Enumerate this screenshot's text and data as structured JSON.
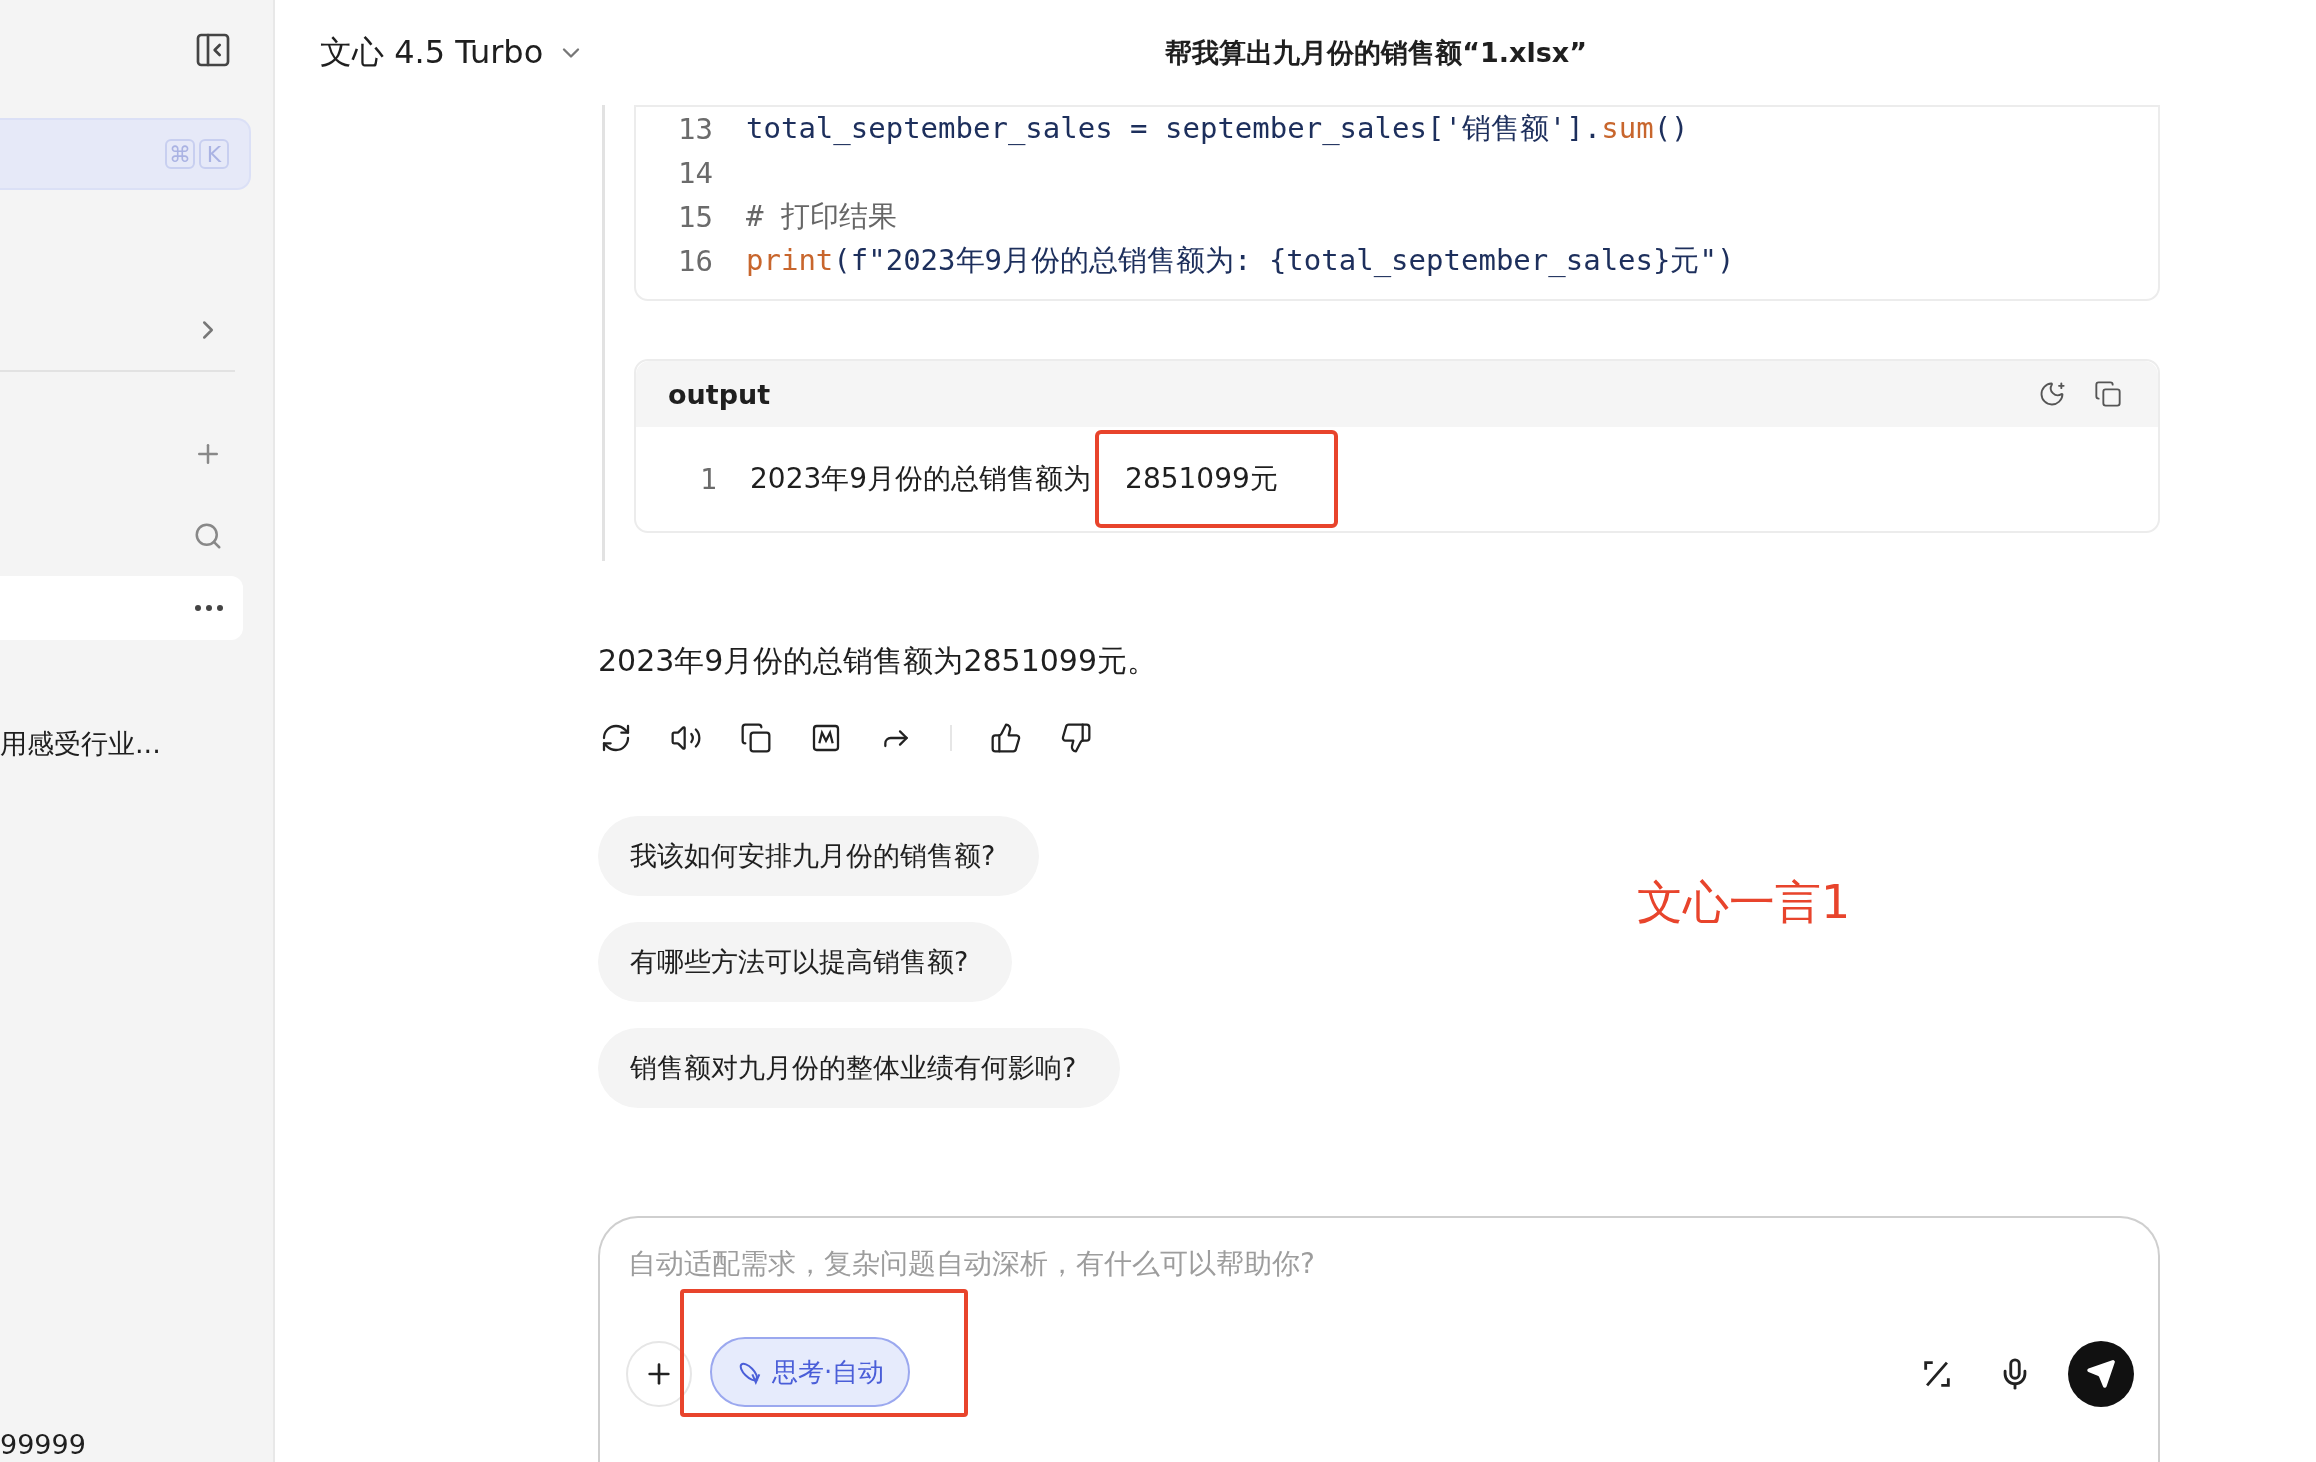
{
  "sidebar": {
    "shortcut_keys": [
      "⌘",
      "K"
    ],
    "recent_item": "用感受行业...",
    "footer_text": "99999"
  },
  "header": {
    "model": "文心 4.5 Turbo",
    "title": "帮我算出九月份的销售额“1.xlsx”"
  },
  "code": {
    "lines": [
      {
        "number": "13",
        "tokens": [
          {
            "kind": "plain",
            "text": "total_september_sales = september_sales["
          },
          {
            "kind": "string",
            "text": "'销售额'"
          },
          {
            "kind": "plain",
            "text": "]."
          },
          {
            "kind": "func",
            "text": "sum"
          },
          {
            "kind": "plain",
            "text": "()"
          }
        ]
      },
      {
        "number": "14"
      },
      {
        "number": "15",
        "tokens": [
          {
            "kind": "comment",
            "text": "# 打印结果"
          }
        ]
      },
      {
        "number": "16",
        "tokens": [
          {
            "kind": "func",
            "text": "print"
          },
          {
            "kind": "plain",
            "text": "(f\"2023年9月份的总销售额为: {total_september_sales}元\")"
          }
        ]
      }
    ]
  },
  "output": {
    "title": "output",
    "lines": [
      {
        "number": "1",
        "segments": [
          {
            "text": "2023年9月份的总销售额为",
            "highlighted": false
          },
          {
            "text": "2851099元",
            "highlighted": true
          }
        ]
      }
    ]
  },
  "answer": "2023年9月份的总销售额为2851099元。",
  "suggestions": [
    "我该如何安排九月份的销售额?",
    "有哪些方法可以提高销售额?",
    "销售额对九月份的整体业绩有何影响?"
  ],
  "annotation": {
    "text": "文心一言1",
    "color": "#e8442c"
  },
  "composer": {
    "placeholder": "自动适配需求，复杂问题自动深析，有什么可以帮助你?",
    "mode_chip": {
      "label": "思考·自动",
      "highlighted": true
    }
  }
}
